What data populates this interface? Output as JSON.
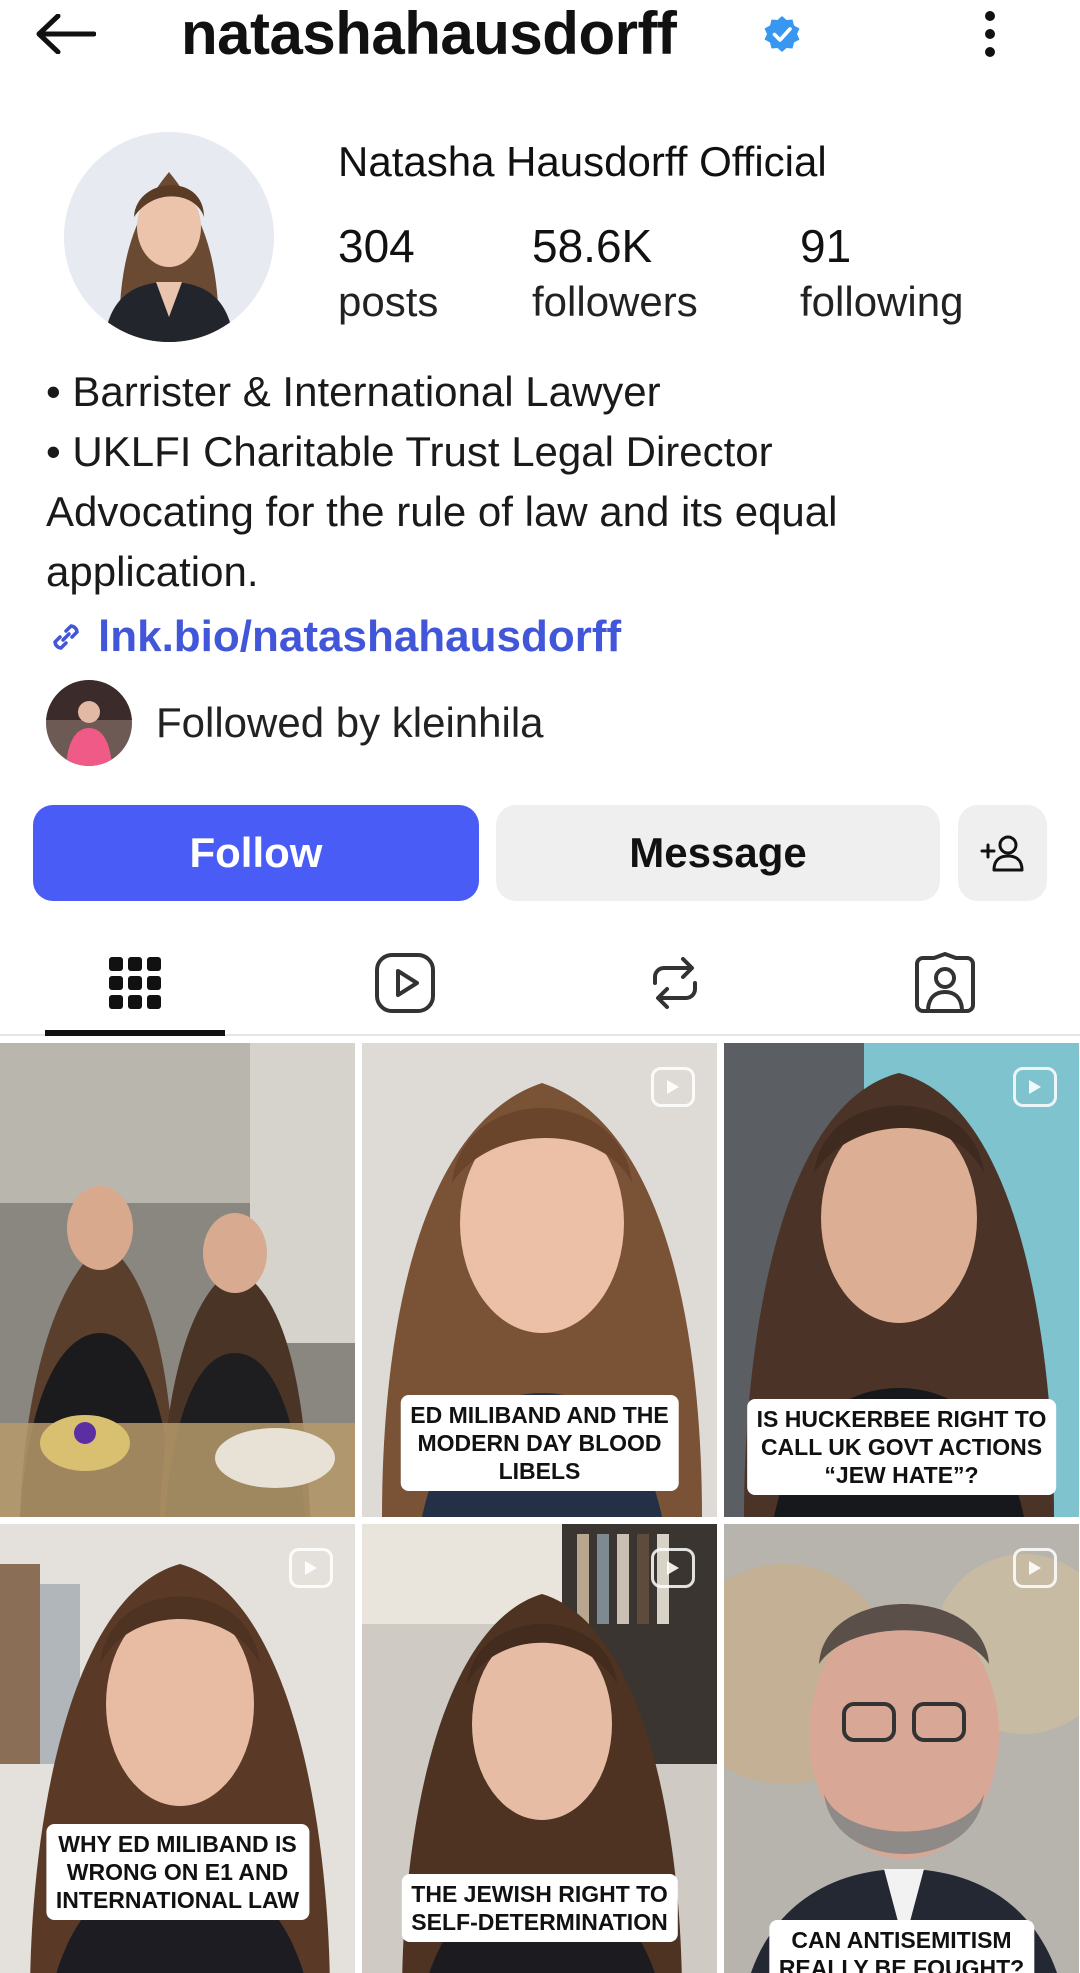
{
  "header": {
    "username": "natashahausdorff",
    "verified_color": "#3897f0"
  },
  "profile": {
    "display_name": "Natasha Hausdorff Official",
    "stats": [
      {
        "value": "304",
        "label": "posts"
      },
      {
        "value": "58.6K",
        "label": "followers"
      },
      {
        "value": "91",
        "label": "following"
      }
    ],
    "bio_lines": [
      "• Barrister & International Lawyer",
      "• UKLFI Charitable Trust Legal Director",
      "Advocating for the rule of law and its equal",
      "application."
    ],
    "link": "lnk.bio/natashahausdorff",
    "followed_by": "Followed by kleinhila"
  },
  "actions": {
    "follow_label": "Follow",
    "message_label": "Message"
  },
  "tabs": [
    {
      "name": "grid",
      "icon": "grid-icon",
      "selected": true
    },
    {
      "name": "reels",
      "icon": "reels-icon",
      "selected": false
    },
    {
      "name": "reposts",
      "icon": "repost-icon",
      "selected": false
    },
    {
      "name": "tagged",
      "icon": "tagged-icon",
      "selected": false
    }
  ],
  "posts": [
    {
      "type": "photo",
      "caption": ""
    },
    {
      "type": "reel",
      "caption": [
        "ED MILIBAND AND THE",
        "MODERN DAY BLOOD",
        "LIBELS"
      ]
    },
    {
      "type": "reel",
      "caption": [
        "IS HUCKERBEE RIGHT TO",
        "CALL UK GOVT ACTIONS",
        "“JEW HATE”?"
      ]
    },
    {
      "type": "reel",
      "caption": [
        "WHY ED MILIBAND IS",
        "WRONG ON E1 AND",
        "INTERNATIONAL LAW"
      ]
    },
    {
      "type": "reel",
      "caption": [
        "THE JEWISH RIGHT TO",
        "SELF-DETERMINATION"
      ]
    },
    {
      "type": "reel",
      "caption": [
        "CAN ANTISEMITISM",
        "REALLY BE FOUGHT?"
      ]
    }
  ],
  "colors": {
    "accent": "#4a5cf6",
    "link": "#4156d8"
  }
}
